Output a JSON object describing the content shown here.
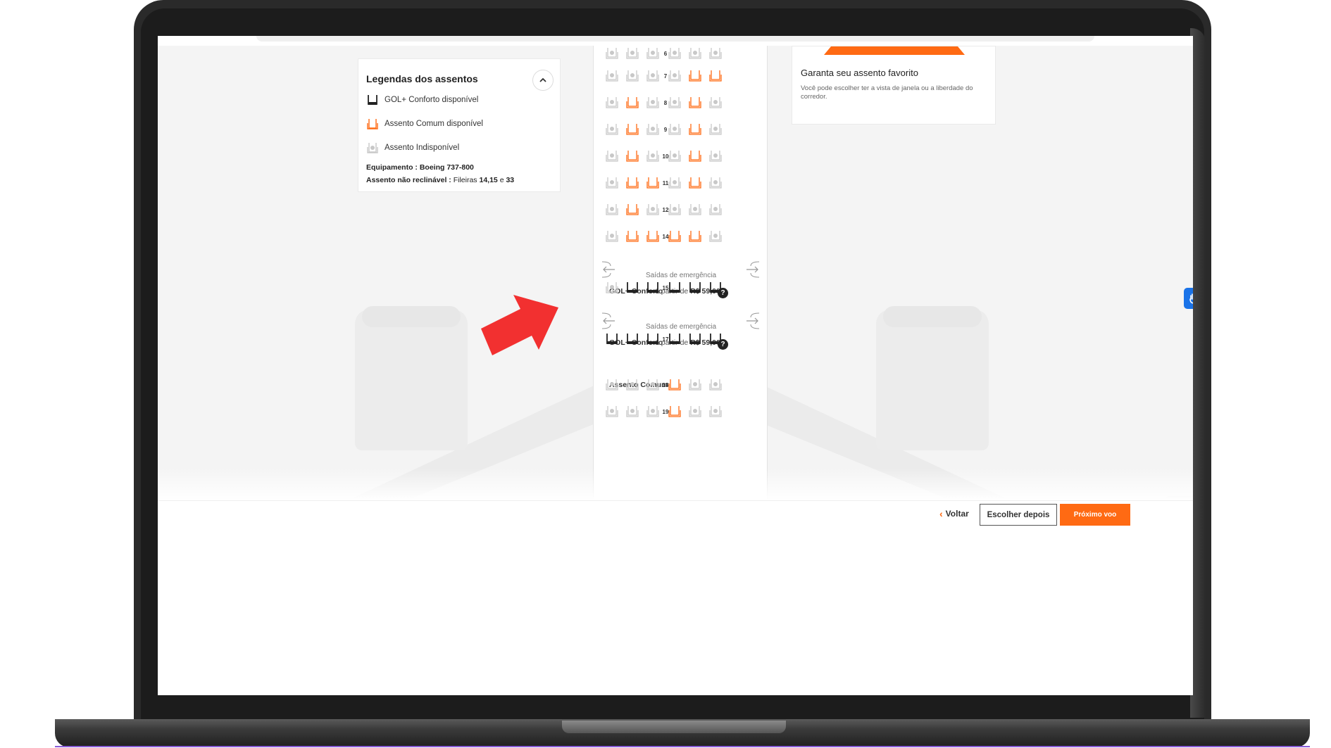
{
  "legend": {
    "title": "Legendas dos assentos",
    "toggle_icon": "chevron-up-icon",
    "items": [
      {
        "label": "GOL+ Conforto disponível",
        "kind": "comfort"
      },
      {
        "label": "Assento Comum disponível",
        "kind": "common"
      },
      {
        "label": "Assento Indisponível",
        "kind": "unavailable"
      }
    ],
    "equipment_label": "Equipamento :",
    "equipment_value": "Boeing 737-800",
    "recline_label": "Assento não reclinável :",
    "recline_prefix": "Fileiras",
    "recline_rows": "14,15",
    "recline_and": "e",
    "recline_last": "33"
  },
  "promo": {
    "title": "Garanta seu assento favorito",
    "text": "Você pode escolher ter a vista de janela ou a liberdade do corredor."
  },
  "seatmap": {
    "rows": [
      {
        "num": "6",
        "seats": [
          "u",
          "u",
          "u",
          "u",
          "u",
          "u"
        ]
      },
      {
        "num": "7",
        "seats": [
          "u",
          "u",
          "u",
          "u",
          "c",
          "c"
        ]
      },
      {
        "num": "8",
        "seats": [
          "u",
          "c",
          "u",
          "u",
          "c",
          "u"
        ]
      },
      {
        "num": "9",
        "seats": [
          "u",
          "c",
          "u",
          "u",
          "c",
          "u"
        ]
      },
      {
        "num": "10",
        "seats": [
          "u",
          "c",
          "u",
          "u",
          "c",
          "u"
        ]
      },
      {
        "num": "11",
        "seats": [
          "u",
          "c",
          "c",
          "u",
          "c",
          "u"
        ]
      },
      {
        "num": "12",
        "seats": [
          "u",
          "c",
          "u",
          "u",
          "u",
          "u"
        ]
      },
      {
        "num": "14",
        "seats": [
          "u",
          "c",
          "c",
          "c",
          "c",
          "u"
        ]
      },
      {
        "num": "15",
        "seats": [
          "u",
          "p",
          "p",
          "p",
          "p",
          "p"
        ]
      },
      {
        "num": "17",
        "seats": [
          "p",
          "p",
          "p",
          "p",
          "p",
          "p"
        ]
      },
      {
        "num": "18",
        "seats": [
          "u",
          "u",
          "u",
          "c",
          "u",
          "u"
        ]
      },
      {
        "num": "19",
        "seats": [
          "u",
          "u",
          "u",
          "c",
          "u",
          "u"
        ]
      }
    ],
    "exit_label_1": "Saídas de emergência",
    "exit_label_2": "Saídas de emergência",
    "comfort_section_1": {
      "name": "GOL+ Conforto",
      "price_prefix": "a partir de",
      "price": "R$ 59,00",
      "help": "?"
    },
    "comfort_section_2": {
      "name": "GOL+ Conforto",
      "price_prefix": "a partir de",
      "price": "R$ 59,00",
      "help": "?"
    },
    "common_section": "Assento Comum"
  },
  "actions": {
    "back": "Voltar",
    "later": "Escolher depois",
    "next": "Próximo voo"
  },
  "colors": {
    "accent": "#ff6a13",
    "unavailable": "#c8c8c8",
    "comfort": "#222222",
    "highlight_arrow": "#f23030",
    "a11y": "#1a73e8"
  }
}
